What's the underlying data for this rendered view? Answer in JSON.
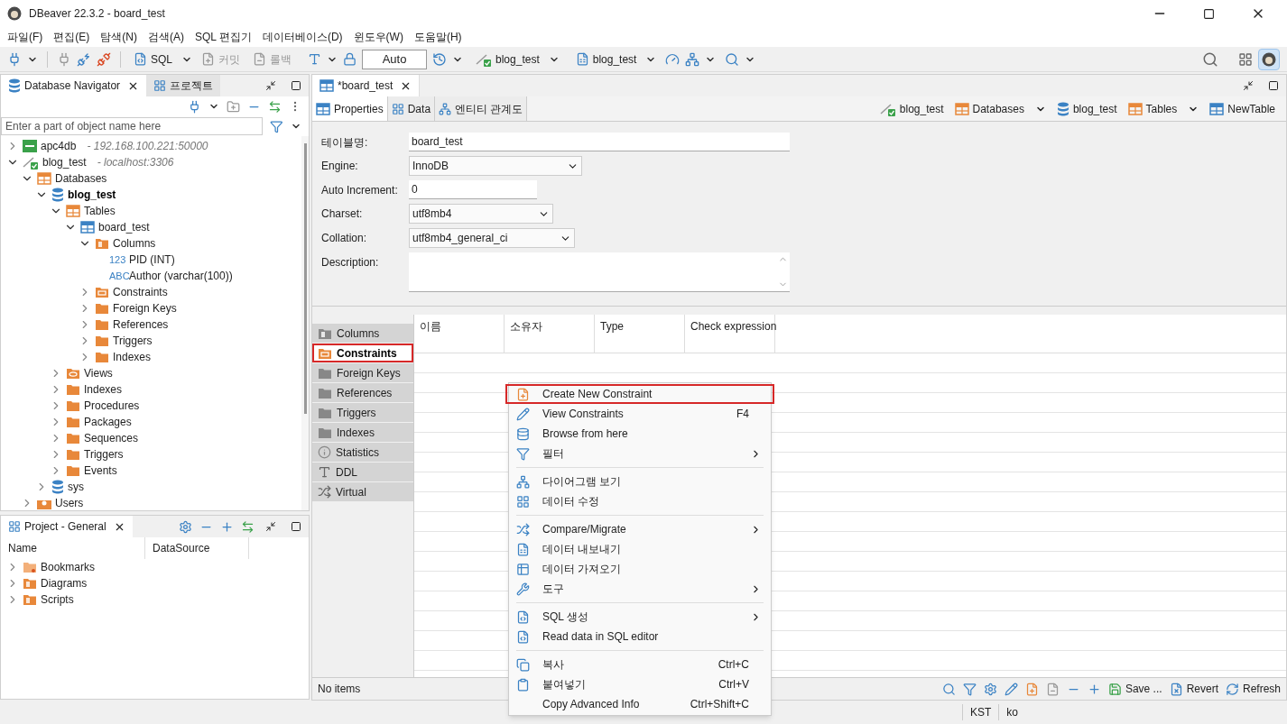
{
  "window": {
    "title": "DBeaver 22.3.2 - board_test"
  },
  "menu": [
    "파일(F)",
    "편집(E)",
    "탐색(N)",
    "검색(A)",
    "SQL 편집기",
    "데이터베이스(D)",
    "윈도우(W)",
    "도움말(H)"
  ],
  "toolbar": {
    "sql": "SQL",
    "commit": {
      "label": "커밋",
      "disabled": true
    },
    "rollback": {
      "label": "롤백",
      "disabled": true
    },
    "transaction_mode": "Auto",
    "datasource": "blog_test",
    "schema": "blog_test"
  },
  "navigator": {
    "tabs": [
      {
        "label": "Database Navigator",
        "selected": true
      },
      {
        "label": "프로젝트",
        "selected": false
      }
    ],
    "filter": {
      "placeholder": "Enter a part of object name here"
    },
    "tree": [
      {
        "label": "apc4db",
        "host": "- 192.168.100.221:50000",
        "kind": "db2",
        "active": false,
        "expanded": false
      },
      {
        "label": "blog_test",
        "host": "- localhost:3306",
        "kind": "connection",
        "active": false,
        "expanded": true,
        "children": [
          {
            "label": "Databases",
            "kind": "databases",
            "active": false,
            "expanded": true,
            "children": [
              {
                "label": "blog_test",
                "kind": "database",
                "active": true,
                "expanded": true,
                "children": [
                  {
                    "label": "Tables",
                    "kind": "tables",
                    "active": false,
                    "expanded": true,
                    "children": [
                      {
                        "label": "board_test",
                        "kind": "table",
                        "active": false,
                        "expanded": true,
                        "children": [
                          {
                            "label": "Columns",
                            "kind": "columns",
                            "active": false,
                            "expanded": true,
                            "children": [
                              {
                                "label": "PID (INT)",
                                "kind": "column",
                                "type_tag": "123",
                                "active": false
                              },
                              {
                                "label": "Author (varchar(100))",
                                "kind": "column",
                                "type_tag": "ABC",
                                "active": false
                              }
                            ]
                          },
                          {
                            "label": "Constraints",
                            "kind": "constraints",
                            "active": false,
                            "expanded": false
                          },
                          {
                            "label": "Foreign Keys",
                            "kind": "folder",
                            "active": false,
                            "expanded": false
                          },
                          {
                            "label": "References",
                            "kind": "folder",
                            "active": false,
                            "expanded": false
                          },
                          {
                            "label": "Triggers",
                            "kind": "folder",
                            "active": false,
                            "expanded": false
                          },
                          {
                            "label": "Indexes",
                            "kind": "folder",
                            "active": false,
                            "expanded": false
                          }
                        ]
                      }
                    ]
                  },
                  {
                    "label": "Views",
                    "kind": "views",
                    "active": false,
                    "expanded": false
                  },
                  {
                    "label": "Indexes",
                    "kind": "folder",
                    "active": false,
                    "expanded": false
                  },
                  {
                    "label": "Procedures",
                    "kind": "folder",
                    "active": false,
                    "expanded": false
                  },
                  {
                    "label": "Packages",
                    "kind": "folder",
                    "active": false,
                    "expanded": false
                  },
                  {
                    "label": "Sequences",
                    "kind": "folder",
                    "active": false,
                    "expanded": false
                  },
                  {
                    "label": "Triggers",
                    "kind": "folder",
                    "active": false,
                    "expanded": false
                  },
                  {
                    "label": "Events",
                    "kind": "folder",
                    "active": false,
                    "expanded": false
                  }
                ]
              },
              {
                "label": "sys",
                "kind": "database",
                "active": false,
                "expanded": false
              }
            ]
          },
          {
            "label": "Users",
            "kind": "users",
            "active": false,
            "expanded": false
          }
        ]
      }
    ]
  },
  "project": {
    "tab": "Project - General",
    "columns": [
      "Name",
      "DataSource"
    ],
    "items": [
      {
        "label": "Bookmarks",
        "kind": "bookmarks",
        "expanded": false
      },
      {
        "label": "Diagrams",
        "kind": "diagrams",
        "expanded": false
      },
      {
        "label": "Scripts",
        "kind": "scripts",
        "expanded": false
      }
    ]
  },
  "editor": {
    "tab": "*board_test",
    "subtabs": [
      {
        "label": "Properties",
        "selected": true
      },
      {
        "label": "Data",
        "selected": false
      },
      {
        "label": "엔티티 관계도",
        "selected": false
      }
    ],
    "breadcrumb": [
      {
        "label": "blog_test",
        "kind": "connection",
        "dropdown": false
      },
      {
        "label": "Databases",
        "kind": "databases",
        "dropdown": true
      },
      {
        "label": "blog_test",
        "kind": "database",
        "dropdown": false
      },
      {
        "label": "Tables",
        "kind": "tables",
        "dropdown": true
      },
      {
        "label": "NewTable",
        "kind": "table",
        "dropdown": false
      }
    ],
    "form": [
      {
        "label": "테이블명:",
        "kind": "text",
        "value": "board_test"
      },
      {
        "label": "Engine:",
        "kind": "select",
        "value": "InnoDB"
      },
      {
        "label": "Auto Increment:",
        "kind": "text",
        "value": "0"
      },
      {
        "label": "Charset:",
        "kind": "select",
        "value": "utf8mb4"
      },
      {
        "label": "Collation:",
        "kind": "select",
        "value": "utf8mb4_general_ci"
      },
      {
        "label": "Description:",
        "kind": "textarea"
      }
    ],
    "side_tabs": [
      {
        "label": "Columns",
        "kind": "columns",
        "selected": false,
        "highlighted": false
      },
      {
        "label": "Constraints",
        "kind": "constraints",
        "selected": true,
        "highlighted": true
      },
      {
        "label": "Foreign Keys",
        "kind": "folder",
        "selected": false,
        "highlighted": false
      },
      {
        "label": "References",
        "kind": "folder",
        "selected": false,
        "highlighted": false
      },
      {
        "label": "Triggers",
        "kind": "folder",
        "selected": false,
        "highlighted": false
      },
      {
        "label": "Indexes",
        "kind": "folder",
        "selected": false,
        "highlighted": false
      },
      {
        "label": "Statistics",
        "kind": "info",
        "selected": false,
        "highlighted": false
      },
      {
        "label": "DDL",
        "kind": "ddl",
        "selected": false,
        "highlighted": false
      },
      {
        "label": "Virtual",
        "kind": "virtual",
        "selected": false,
        "highlighted": false
      }
    ],
    "table": {
      "columns": [
        "이름",
        "소유자",
        "Type",
        "Check expression"
      ]
    },
    "footer": {
      "status": "No items",
      "save": "Save ...",
      "revert": "Revert",
      "refresh": "Refresh"
    }
  },
  "context_menu": [
    {
      "kind": "item",
      "label": "Create New Constraint",
      "highlighted": true,
      "submenu": false
    },
    {
      "kind": "item",
      "label": "View Constraints",
      "shortcut": "F4",
      "highlighted": false,
      "submenu": false
    },
    {
      "kind": "item",
      "label": "Browse from here",
      "highlighted": false,
      "submenu": false
    },
    {
      "kind": "item",
      "label": "필터",
      "highlighted": false,
      "submenu": true
    },
    {
      "kind": "separator"
    },
    {
      "kind": "item",
      "label": "다이어그램 보기",
      "highlighted": false,
      "submenu": false
    },
    {
      "kind": "item",
      "label": "데이터 수정",
      "highlighted": false,
      "submenu": false
    },
    {
      "kind": "separator"
    },
    {
      "kind": "item",
      "label": "Compare/Migrate",
      "highlighted": false,
      "submenu": true
    },
    {
      "kind": "item",
      "label": "데이터 내보내기",
      "highlighted": false,
      "submenu": false
    },
    {
      "kind": "item",
      "label": "데이터 가져오기",
      "highlighted": false,
      "submenu": false
    },
    {
      "kind": "item",
      "label": "도구",
      "highlighted": false,
      "submenu": true
    },
    {
      "kind": "separator"
    },
    {
      "kind": "item",
      "label": "SQL 생성",
      "highlighted": false,
      "submenu": true
    },
    {
      "kind": "item",
      "label": "Read data in SQL editor",
      "highlighted": false,
      "submenu": false
    },
    {
      "kind": "separator"
    },
    {
      "kind": "item",
      "label": "복사",
      "shortcut": "Ctrl+C",
      "highlighted": false,
      "submenu": false
    },
    {
      "kind": "item",
      "label": "붙여넣기",
      "shortcut": "Ctrl+V",
      "highlighted": false,
      "submenu": false
    },
    {
      "kind": "item",
      "label": "Copy Advanced Info",
      "shortcut": "Ctrl+Shift+C",
      "highlighted": false,
      "submenu": false
    }
  ],
  "status_bar": [
    "KST",
    "ko"
  ]
}
